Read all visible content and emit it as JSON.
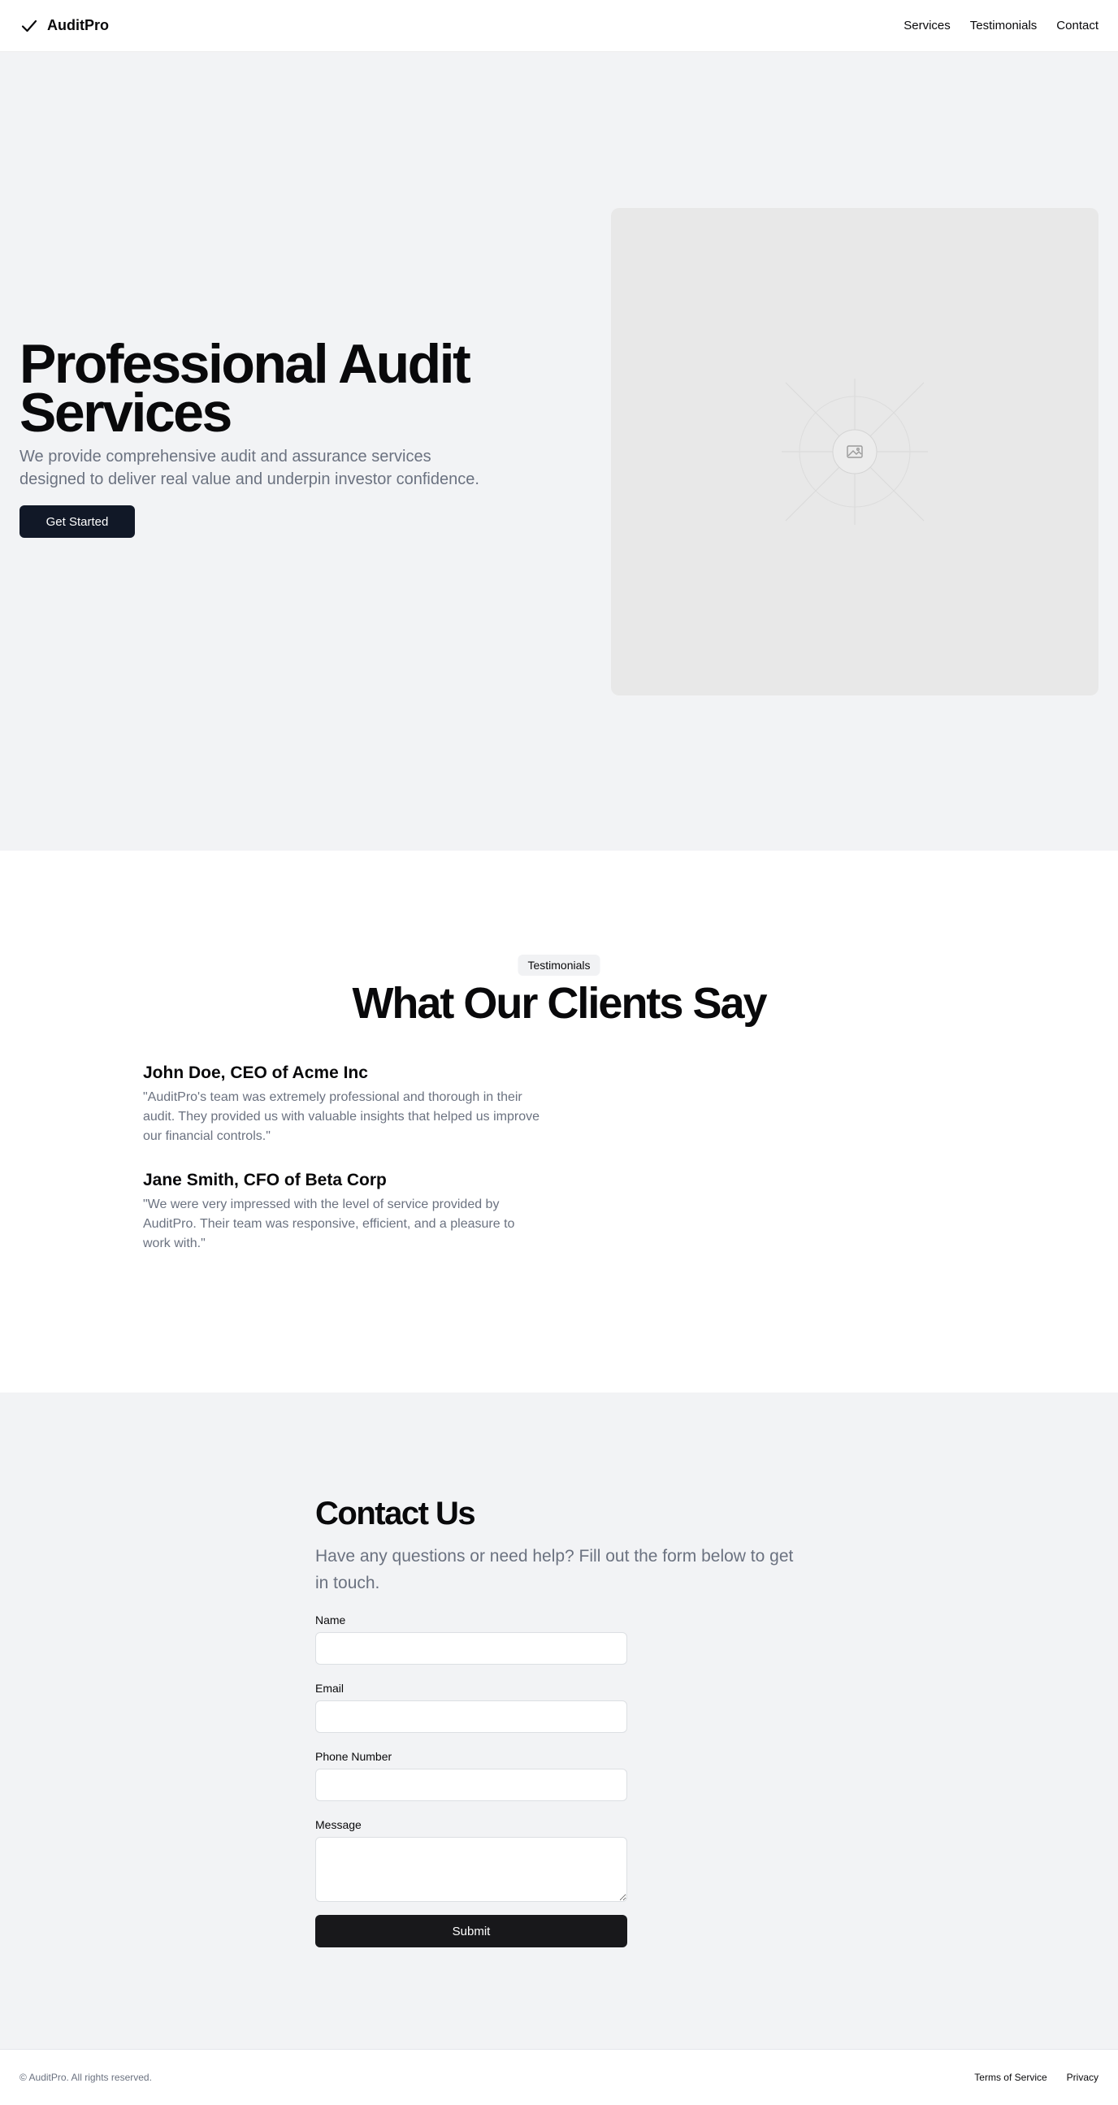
{
  "header": {
    "brand": "AuditPro",
    "brand_icon": "check-icon",
    "nav": [
      "Services",
      "Testimonials",
      "Contact"
    ]
  },
  "hero": {
    "title": "Professional Audit Services",
    "subtitle": "We provide comprehensive audit and assurance services designed to deliver real value and underpin investor confidence.",
    "cta": "Get Started",
    "image_icon": "image-placeholder-icon"
  },
  "testimonials": {
    "badge": "Testimonials",
    "title": "What Our Clients Say",
    "items": [
      {
        "name": "John Doe, CEO of Acme Inc",
        "quote": "\"AuditPro's team was extremely professional and thorough in their audit. They provided us with valuable insights that helped us improve our financial controls.\""
      },
      {
        "name": "Jane Smith, CFO of Beta Corp",
        "quote": "\"We were very impressed with the level of service provided by AuditPro. Their team was responsive, efficient, and a pleasure to work with.\""
      }
    ]
  },
  "contact": {
    "title": "Contact Us",
    "subtitle": "Have any questions or need help? Fill out the form below to get in touch.",
    "fields": {
      "name_label": "Name",
      "email_label": "Email",
      "phone_label": "Phone Number",
      "message_label": "Message"
    },
    "submit": "Submit"
  },
  "footer": {
    "copyright": "© AuditPro. All rights reserved.",
    "links": [
      "Terms of Service",
      "Privacy"
    ]
  },
  "colors": {
    "primary_button": "#111827",
    "submit_button": "#18181b",
    "section_bg": "#f2f3f5",
    "muted_text": "#6b7280"
  }
}
